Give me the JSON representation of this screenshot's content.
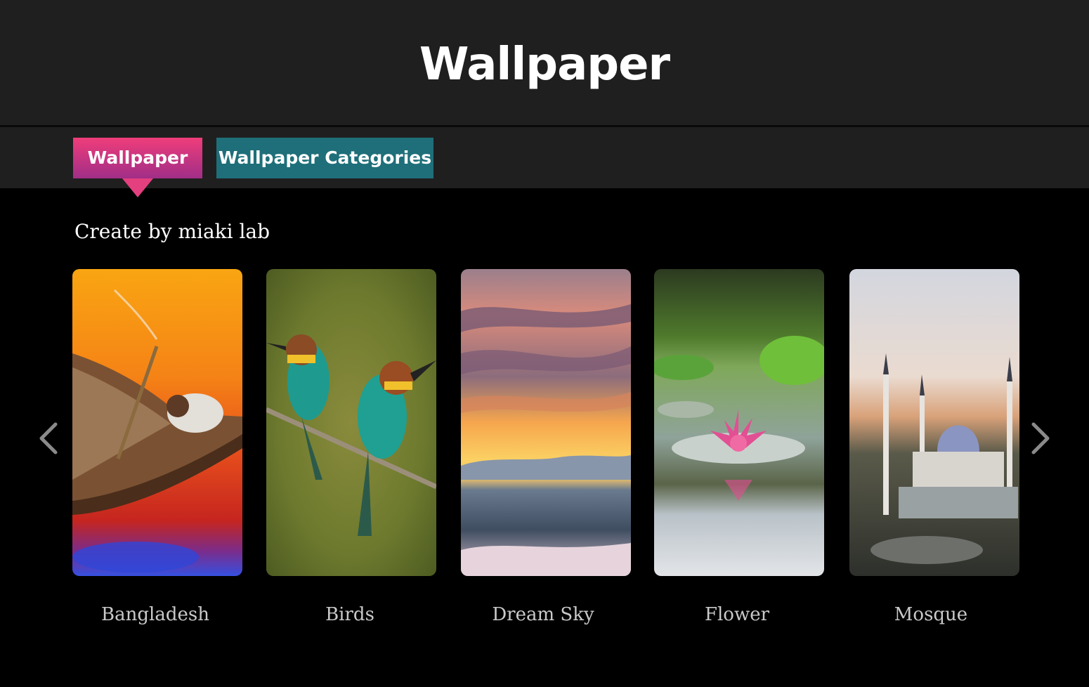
{
  "header": {
    "title": "Wallpaper"
  },
  "tabs": [
    {
      "label": "Wallpaper",
      "active": true
    },
    {
      "label": "Wallpaper Categories",
      "active": false
    }
  ],
  "credit": "Create by miaki lab",
  "carousel": {
    "prev_icon": "chevron-left-icon",
    "next_icon": "chevron-right-icon",
    "items": [
      {
        "label": "Bangladesh"
      },
      {
        "label": "Birds"
      },
      {
        "label": "Dream Sky"
      },
      {
        "label": "Flower"
      },
      {
        "label": "Mosque"
      }
    ]
  },
  "colors": {
    "header_bg": "#201f20",
    "page_bg": "#000000",
    "active_tab": "#e43f7f",
    "inactive_tab": "#1e6f79",
    "label_text": "#c9c9c9"
  }
}
